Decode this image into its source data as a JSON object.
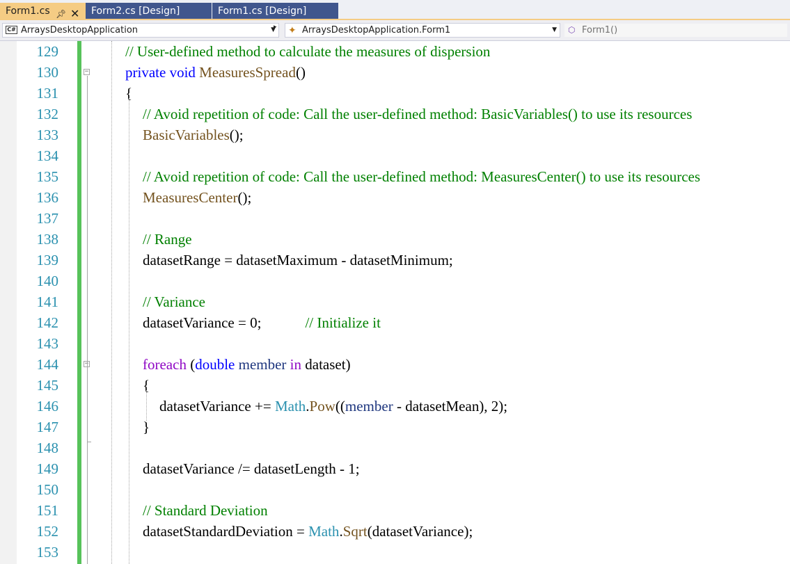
{
  "tabs": [
    {
      "label": "Form1.cs",
      "active": true,
      "pin_icon": "pin-icon",
      "close_icon": "close-icon"
    },
    {
      "label": "Form2.cs [Design]",
      "active": false
    },
    {
      "label": "Form1.cs [Design]",
      "active": false
    }
  ],
  "nav": {
    "project_badge": "C#",
    "project": "ArraysDesktopApplication",
    "class": "ArraysDesktopApplication.Form1",
    "member": "Form1()"
  },
  "colors": {
    "active_tab": "#f5cc84",
    "inactive_tab": "#40568d",
    "line_number": "#2b91af",
    "comment": "#008000",
    "keyword": "#0000ff",
    "method": "#74531f",
    "control_keyword": "#8f08c4",
    "type": "#2b91af",
    "change_bar": "#57c25a"
  },
  "code": {
    "lines": [
      {
        "n": "129",
        "indent": 1,
        "tokens": [
          {
            "t": "// User-defined method to calculate the measures of dispersion",
            "c": "cm"
          }
        ]
      },
      {
        "n": "130",
        "indent": 1,
        "fold": "start",
        "tokens": [
          {
            "t": "private",
            "c": "kw"
          },
          {
            "t": " "
          },
          {
            "t": "void",
            "c": "kw"
          },
          {
            "t": " "
          },
          {
            "t": "MeasuresSpread",
            "c": "fn"
          },
          {
            "t": "()"
          }
        ]
      },
      {
        "n": "131",
        "indent": 1,
        "tokens": [
          {
            "t": "{"
          }
        ]
      },
      {
        "n": "132",
        "indent": 2,
        "tokens": [
          {
            "t": "// Avoid repetition of code: Call the user-defined method: BasicVariables() to use its resources",
            "c": "cm"
          }
        ]
      },
      {
        "n": "133",
        "indent": 2,
        "tokens": [
          {
            "t": "BasicVariables",
            "c": "fn"
          },
          {
            "t": "();"
          }
        ]
      },
      {
        "n": "134",
        "indent": 2,
        "tokens": []
      },
      {
        "n": "135",
        "indent": 2,
        "tokens": [
          {
            "t": "// Avoid repetition of code: Call the user-defined method: MeasuresCenter() to use its resources",
            "c": "cm"
          }
        ]
      },
      {
        "n": "136",
        "indent": 2,
        "tokens": [
          {
            "t": "MeasuresCenter",
            "c": "fn"
          },
          {
            "t": "();"
          }
        ]
      },
      {
        "n": "137",
        "indent": 2,
        "tokens": []
      },
      {
        "n": "138",
        "indent": 2,
        "tokens": [
          {
            "t": "// Range",
            "c": "cm"
          }
        ]
      },
      {
        "n": "139",
        "indent": 2,
        "tokens": [
          {
            "t": "datasetRange = datasetMaximum - datasetMinimum;"
          }
        ]
      },
      {
        "n": "140",
        "indent": 2,
        "tokens": []
      },
      {
        "n": "141",
        "indent": 2,
        "tokens": [
          {
            "t": "// Variance",
            "c": "cm"
          }
        ]
      },
      {
        "n": "142",
        "indent": 2,
        "tokens": [
          {
            "t": "datasetVariance = 0;            "
          },
          {
            "t": "// Initialize it",
            "c": "cm"
          }
        ]
      },
      {
        "n": "143",
        "indent": 2,
        "tokens": []
      },
      {
        "n": "144",
        "indent": 2,
        "fold": "start",
        "tokens": [
          {
            "t": "foreach",
            "c": "ctl"
          },
          {
            "t": " ("
          },
          {
            "t": "double",
            "c": "kw"
          },
          {
            "t": " "
          },
          {
            "t": "member",
            "c": "var"
          },
          {
            "t": " "
          },
          {
            "t": "in",
            "c": "ctl"
          },
          {
            "t": " dataset)"
          }
        ]
      },
      {
        "n": "145",
        "indent": 2,
        "tokens": [
          {
            "t": "{"
          }
        ]
      },
      {
        "n": "146",
        "indent": 3,
        "tokens": [
          {
            "t": "datasetVariance += "
          },
          {
            "t": "Math",
            "c": "typ"
          },
          {
            "t": "."
          },
          {
            "t": "Pow",
            "c": "fn"
          },
          {
            "t": "(("
          },
          {
            "t": "member",
            "c": "var"
          },
          {
            "t": " - datasetMean), 2);"
          }
        ]
      },
      {
        "n": "147",
        "indent": 2,
        "tokens": [
          {
            "t": "}"
          }
        ]
      },
      {
        "n": "148",
        "indent": 2,
        "fold": "end",
        "tokens": []
      },
      {
        "n": "149",
        "indent": 2,
        "tokens": [
          {
            "t": "datasetVariance /= datasetLength - 1;"
          }
        ]
      },
      {
        "n": "150",
        "indent": 2,
        "tokens": []
      },
      {
        "n": "151",
        "indent": 2,
        "tokens": [
          {
            "t": "// Standard Deviation",
            "c": "cm"
          }
        ]
      },
      {
        "n": "152",
        "indent": 2,
        "tokens": [
          {
            "t": "datasetStandardDeviation = "
          },
          {
            "t": "Math",
            "c": "typ"
          },
          {
            "t": "."
          },
          {
            "t": "Sqrt",
            "c": "fn"
          },
          {
            "t": "(datasetVariance);"
          }
        ]
      },
      {
        "n": "153",
        "indent": 2,
        "tokens": []
      }
    ]
  }
}
